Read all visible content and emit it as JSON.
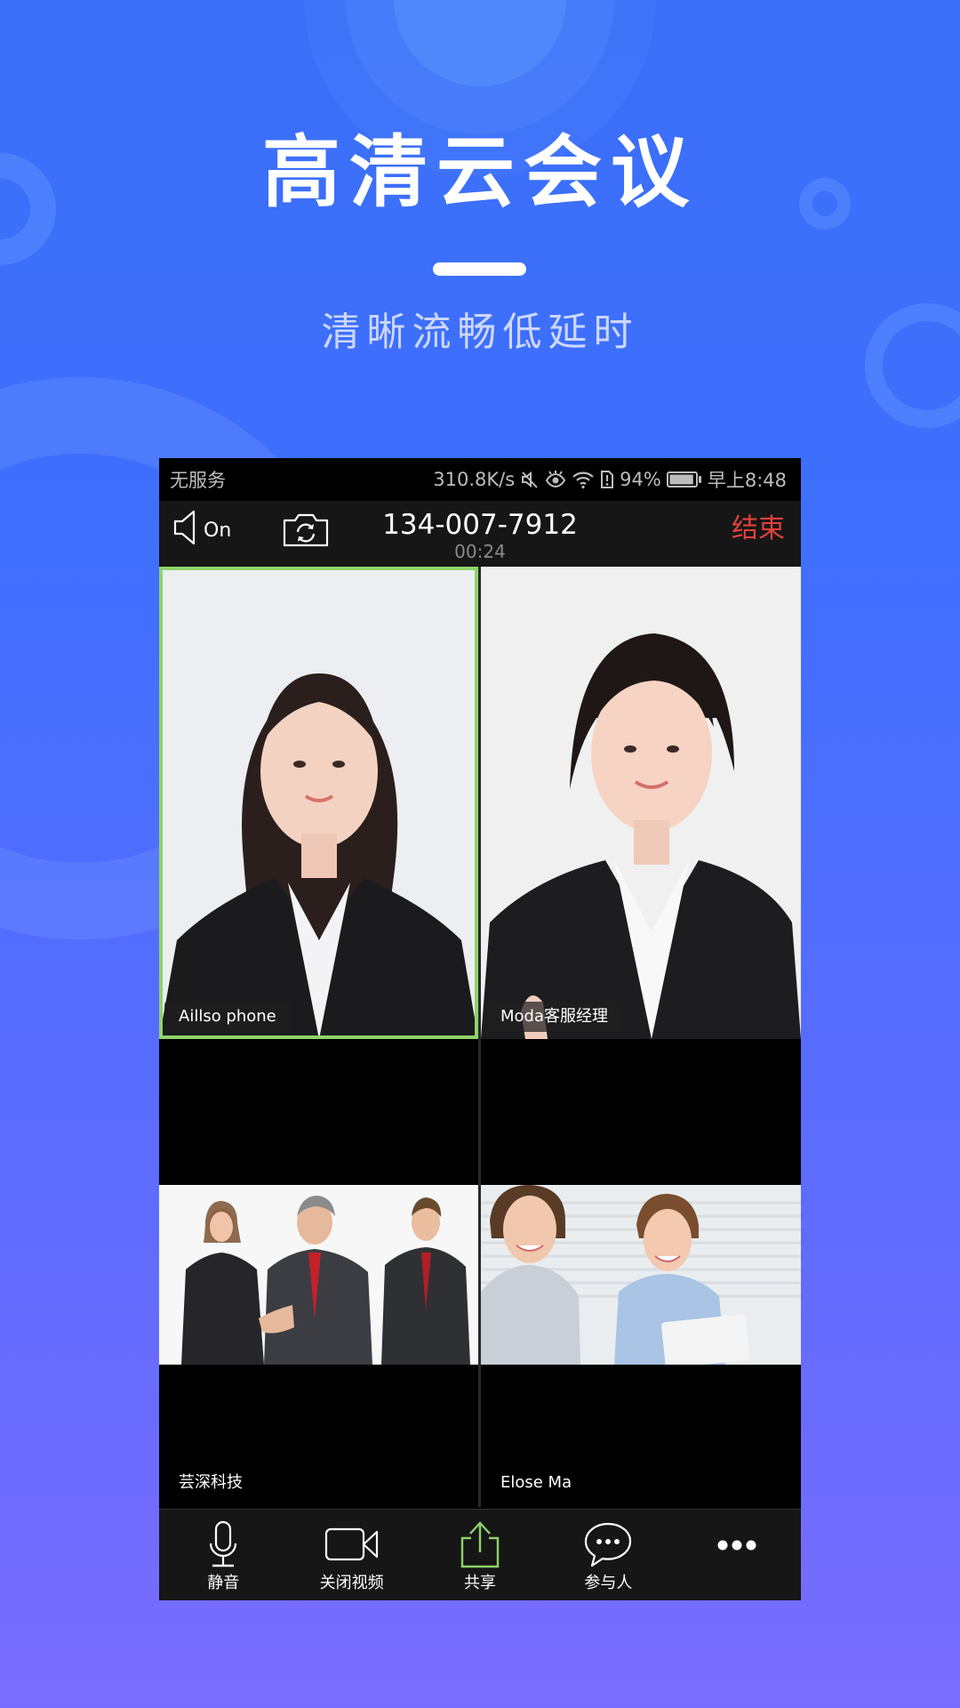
{
  "hero": {
    "title": "高清云会议",
    "subtitle": "清晰流畅低延时"
  },
  "colors": {
    "background_top": "#3a6ff8",
    "background_bottom": "#7a6cff",
    "active_speaker_border": "#8fd36a",
    "end_call": "#e2413b",
    "share_icon": "#8fd36a"
  },
  "status_bar": {
    "carrier": "无服务",
    "network_speed": "310.8K/s",
    "icons": [
      "mute-icon",
      "eye-comfort-icon",
      "wifi-icon",
      "sim-alert-icon"
    ],
    "battery_percent": "94%",
    "battery_level": 0.94,
    "time": "早上8:48"
  },
  "call_bar": {
    "speaker_label": "On",
    "phone_number": "134-007-7912",
    "duration": "00:24",
    "end_label": "结束"
  },
  "participants": [
    {
      "name": "Aillso phone",
      "active": true
    },
    {
      "name": "Moda客服经理",
      "active": false
    },
    {
      "name": "芸深科技",
      "active": false
    },
    {
      "name": "Elose Ma",
      "active": false
    }
  ],
  "toolbar": {
    "items": [
      {
        "label": "静音",
        "icon": "microphone-icon"
      },
      {
        "label": "关闭视频",
        "icon": "video-camera-icon"
      },
      {
        "label": "共享",
        "icon": "share-icon"
      },
      {
        "label": "参与人",
        "icon": "chat-bubble-icon"
      },
      {
        "label": "",
        "icon": "more-icon"
      }
    ]
  }
}
